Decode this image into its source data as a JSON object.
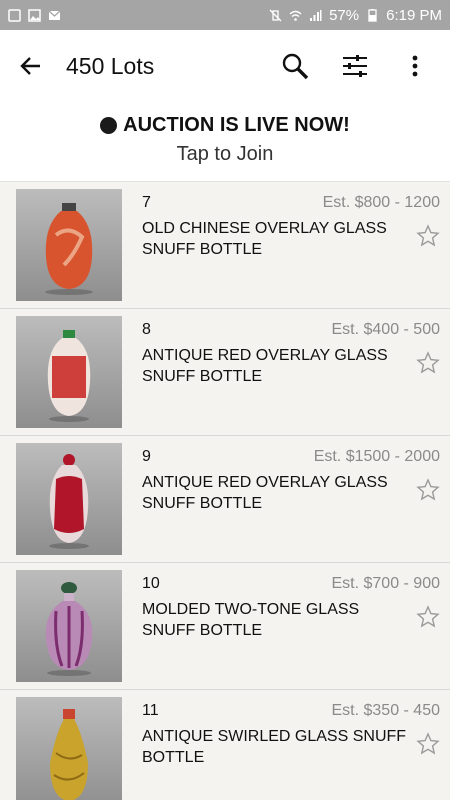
{
  "status": {
    "battery": "57%",
    "time": "6:19 PM"
  },
  "appbar": {
    "title": "450 Lots"
  },
  "banner": {
    "live": "AUCTION IS LIVE NOW!",
    "join": "Tap to Join"
  },
  "lots": [
    {
      "number": "7",
      "estimate": "Est. $800 - 1200",
      "name": "OLD CHINESE OVERLAY GLASS SNUFF BOTTLE",
      "color": "#d8542f"
    },
    {
      "number": "8",
      "estimate": "Est. $400 - 500",
      "name": "ANTIQUE RED OVERLAY GLASS SNUFF BOTTLE",
      "color": "#c8221e"
    },
    {
      "number": "9",
      "estimate": "Est. $1500 - 2000",
      "name": "ANTIQUE RED OVERLAY GLASS SNUFF BOTTLE",
      "color": "#b0152a"
    },
    {
      "number": "10",
      "estimate": "Est. $700 - 900",
      "name": "MOLDED TWO-TONE GLASS SNUFF BOTTLE",
      "color": "#b88ab5"
    },
    {
      "number": "11",
      "estimate": "Est. $350 - 450",
      "name": "ANTIQUE SWIRLED GLASS SNUFF BOTTLE",
      "color": "#c9a32c"
    }
  ]
}
